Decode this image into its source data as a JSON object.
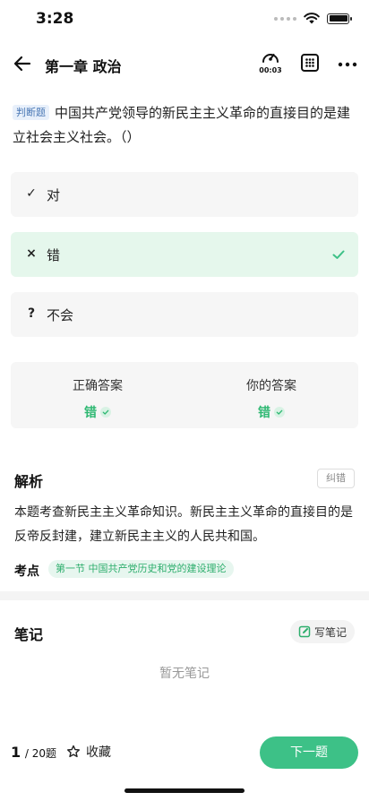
{
  "status": {
    "time": "3:28"
  },
  "nav": {
    "title": "第一章 政治",
    "timer": "00:03"
  },
  "question": {
    "type_tag": "判断题",
    "text": "中国共产党领导的新民主主义革命的直接目的是建立社会主义社会。（）"
  },
  "options": [
    {
      "mark": "✓",
      "label": "对"
    },
    {
      "mark": "×",
      "label": "错"
    },
    {
      "mark": "?",
      "label": "不会"
    }
  ],
  "answers": {
    "correct_title": "正确答案",
    "correct_value": "错",
    "yours_title": "你的答案",
    "yours_value": "错"
  },
  "analysis": {
    "title": "解析",
    "report_label": "纠错",
    "text": "本题考查新民主主义革命知识。新民主主义革命的直接目的是反帝反封建，建立新民主主义的人民共和国。",
    "point_label": "考点",
    "point_chip": "第一节 中国共产党历史和党的建设理论"
  },
  "notes": {
    "title": "笔记",
    "write_label": "写笔记",
    "empty_text": "暂无笔记"
  },
  "footer": {
    "current": "1",
    "total": "/ 20题",
    "favorite_label": "收藏",
    "next_label": "下一题"
  },
  "colors": {
    "accent": "#3dc187",
    "correct_bg": "#e5f7ec",
    "tag_bg": "#e8f0fb"
  }
}
